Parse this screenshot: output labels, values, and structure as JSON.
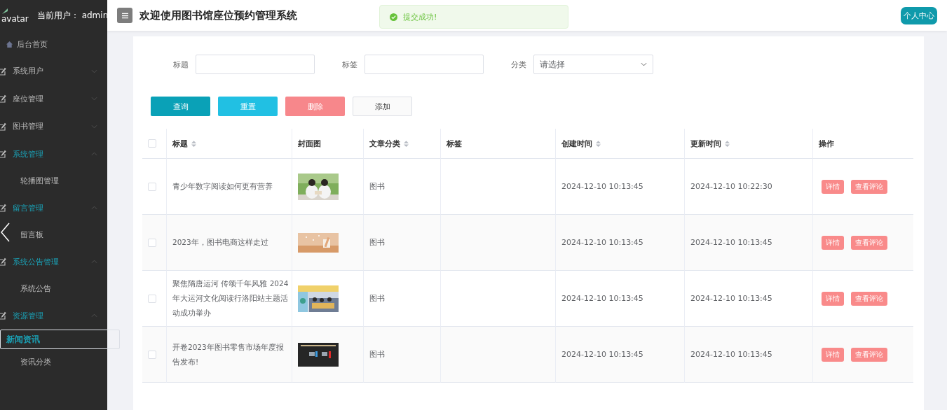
{
  "sidebar": {
    "avatar_alt": "avatar",
    "user_label": "当前用户：",
    "user_name": "admin",
    "items": [
      {
        "kind": "link",
        "label": "后台首页",
        "selected": false
      },
      {
        "kind": "group",
        "label": "系统用户",
        "expanded": false
      },
      {
        "kind": "group",
        "label": "座位管理",
        "expanded": false
      },
      {
        "kind": "group",
        "label": "图书管理",
        "expanded": false
      },
      {
        "kind": "group",
        "label": "系统管理",
        "expanded": true,
        "children": [
          {
            "label": "轮播图管理",
            "selected": false
          }
        ]
      },
      {
        "kind": "group",
        "label": "留言管理",
        "expanded": true,
        "children": [
          {
            "label": "留言板",
            "selected": false
          }
        ]
      },
      {
        "kind": "group",
        "label": "系统公告管理",
        "expanded": true,
        "children": [
          {
            "label": "系统公告",
            "selected": false
          }
        ]
      },
      {
        "kind": "group",
        "label": "资源管理",
        "expanded": true,
        "children": [
          {
            "label": "新闻资讯",
            "selected": true
          },
          {
            "label": "资讯分类",
            "selected": false
          }
        ]
      }
    ]
  },
  "header": {
    "title": "欢迎使用图书馆座位预约管理系统",
    "profile_button": "个人中心"
  },
  "toast": {
    "message": "提交成功!"
  },
  "filters": [
    {
      "kind": "input",
      "label": "标题"
    },
    {
      "kind": "input",
      "label": "标签"
    },
    {
      "kind": "select",
      "label": "分类",
      "placeholder": "请选择"
    }
  ],
  "buttons": [
    {
      "kind": "primary",
      "label": "查询"
    },
    {
      "kind": "info",
      "label": "重置"
    },
    {
      "kind": "danger",
      "label": "删除"
    },
    {
      "kind": "plain",
      "label": "添加"
    }
  ],
  "table": {
    "header_checked": false,
    "columns": [
      {
        "label": "标题",
        "sortable": true
      },
      {
        "label": "封面图",
        "sortable": false
      },
      {
        "label": "文章分类",
        "sortable": true
      },
      {
        "label": "标签",
        "sortable": false
      },
      {
        "label": "创建时间",
        "sortable": true
      },
      {
        "label": "更新时间",
        "sortable": true
      },
      {
        "label": "操作",
        "sortable": false
      }
    ],
    "rows": [
      {
        "checked": false,
        "title": "青少年数字阅读如何更有营养",
        "cover": {
          "kind": "picture"
        },
        "category": "图书",
        "created": "2024-12-10 10:13:45",
        "updated": "2024-12-10 10:22:30",
        "actions": [
          "详情",
          "查看评论"
        ]
      },
      {
        "checked": false,
        "title": "2023年，图书电商这样走过",
        "cover": {
          "kind": "picture"
        },
        "category": "图书",
        "created": "2024-12-10 10:13:45",
        "updated": "2024-12-10 10:13:45",
        "actions": [
          "详情",
          "查看评论"
        ]
      },
      {
        "checked": false,
        "title": "聚焦隋唐运河 传颂千年风雅 2024年大运河文化阅读行洛阳站主题活动成功举办",
        "cover": {
          "kind": "picture"
        },
        "category": "图书",
        "created": "2024-12-10 10:13:45",
        "updated": "2024-12-10 10:13:45",
        "actions": [
          "详情",
          "查看评论"
        ]
      },
      {
        "checked": false,
        "title": "开卷2023年图书零售市场年度报告发布!",
        "cover": {
          "kind": "picture"
        },
        "category": "图书",
        "created": "2024-12-10 10:13:45",
        "updated": "2024-12-10 10:13:45",
        "actions": [
          "详情",
          "查看评论"
        ]
      }
    ]
  }
}
